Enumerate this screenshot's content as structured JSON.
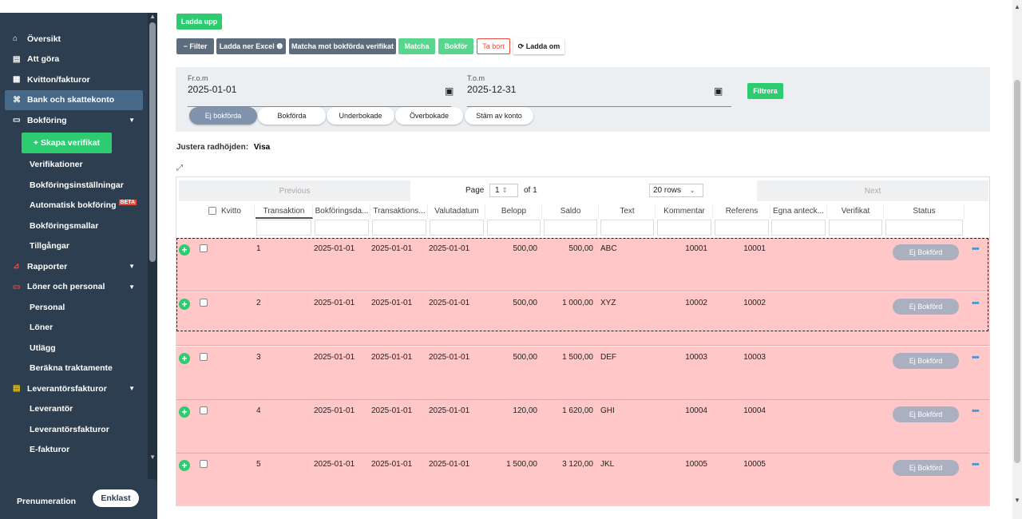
{
  "sidebar": {
    "items": [
      {
        "icon": "home-icon",
        "glyph": "⌂",
        "label": "Översikt"
      },
      {
        "icon": "list-icon",
        "glyph": "▤",
        "label": "Att göra"
      },
      {
        "icon": "receipt-icon",
        "glyph": "▦",
        "label": "Kvitton/fakturor"
      },
      {
        "icon": "bank-icon",
        "glyph": "⌘",
        "label": "Bank och skattekonto",
        "active": true
      },
      {
        "icon": "book-icon",
        "glyph": "▭",
        "label": "Bokföring",
        "caret": true
      }
    ],
    "create_label": "+ Skapa verifikat",
    "sub_bokforing": [
      "Verifikationer",
      "Bokföringsinställningar",
      "Automatisk bokföring",
      "Bokföringsmallar",
      "Tillgångar"
    ],
    "beta_label": "BETA",
    "items2": [
      {
        "icon": "chart-icon",
        "label": "Rapporter"
      },
      {
        "icon": "wallet-icon",
        "label": "Löner och personal"
      }
    ],
    "sub_loner": [
      "Personal",
      "Löner",
      "Utlägg",
      "Beräkna traktamente"
    ],
    "items3": [
      {
        "icon": "invoice-icon",
        "label": "Leverantörsfakturor"
      }
    ],
    "sub_lev": [
      "Leverantör",
      "Leverantörsfakturor",
      "E-fakturor"
    ],
    "plan_label": "Prenumeration",
    "plan_toggle": "Enklast"
  },
  "toolbar": {
    "upload": "Ladda upp",
    "filter": "− Filter",
    "excel": "Ladda ner Excel ❶",
    "match_posted": "Matcha mot bokförda verifikat",
    "match": "Matcha",
    "post": "Bokför",
    "delete": "Ta bort",
    "reload": "⟳ Ladda om"
  },
  "filters": {
    "from_label": "Fr.o.m",
    "from_value": "2025-01-01",
    "to_label": "T.o.m",
    "to_value": "2025-12-31",
    "apply": "Filtrera",
    "pills": [
      "Ej bokförda",
      "Bokförda",
      "Underbokade",
      "Överbokade",
      "Stäm av konto"
    ]
  },
  "row_height": {
    "label": "Justera radhöjden:",
    "value": "Visa"
  },
  "pager": {
    "previous": "Previous",
    "page_label": "Page",
    "page": "1",
    "of": "of 1",
    "rows": "20 rows",
    "next": "Next"
  },
  "columns": [
    "Kvitto",
    "Transaktion",
    "Bokföringsda...",
    "Transaktions...",
    "Valutadatum",
    "Belopp",
    "Saldo",
    "Text",
    "Kommentar",
    "Referens",
    "Egna anteck...",
    "Verifikat",
    "Status"
  ],
  "rows": [
    {
      "tx": "1",
      "bok": "2025-01-01",
      "trans": "2025-01-01",
      "valuta": "2025-01-01",
      "belopp": "500,00",
      "saldo": "500,00",
      "text": "ABC",
      "kommentar": "10001",
      "referens": "10001",
      "status": "Ej Bokförd"
    },
    {
      "tx": "2",
      "bok": "2025-01-01",
      "trans": "2025-01-01",
      "valuta": "2025-01-01",
      "belopp": "500,00",
      "saldo": "1 000,00",
      "text": "XYZ",
      "kommentar": "10002",
      "referens": "10002",
      "status": "Ej Bokförd"
    },
    {
      "tx": "3",
      "bok": "2025-01-01",
      "trans": "2025-01-01",
      "valuta": "2025-01-01",
      "belopp": "500,00",
      "saldo": "1 500,00",
      "text": "DEF",
      "kommentar": "10003",
      "referens": "10003",
      "status": "Ej Bokförd"
    },
    {
      "tx": "4",
      "bok": "2025-01-01",
      "trans": "2025-01-01",
      "valuta": "2025-01-01",
      "belopp": "120,00",
      "saldo": "1 620,00",
      "text": "GHI",
      "kommentar": "10004",
      "referens": "10004",
      "status": "Ej Bokförd"
    },
    {
      "tx": "5",
      "bok": "2025-01-01",
      "trans": "2025-01-01",
      "valuta": "2025-01-01",
      "belopp": "1 500,00",
      "saldo": "3 120,00",
      "text": "JKL",
      "kommentar": "10005",
      "referens": "10005",
      "status": "Ej Bokförd"
    }
  ]
}
